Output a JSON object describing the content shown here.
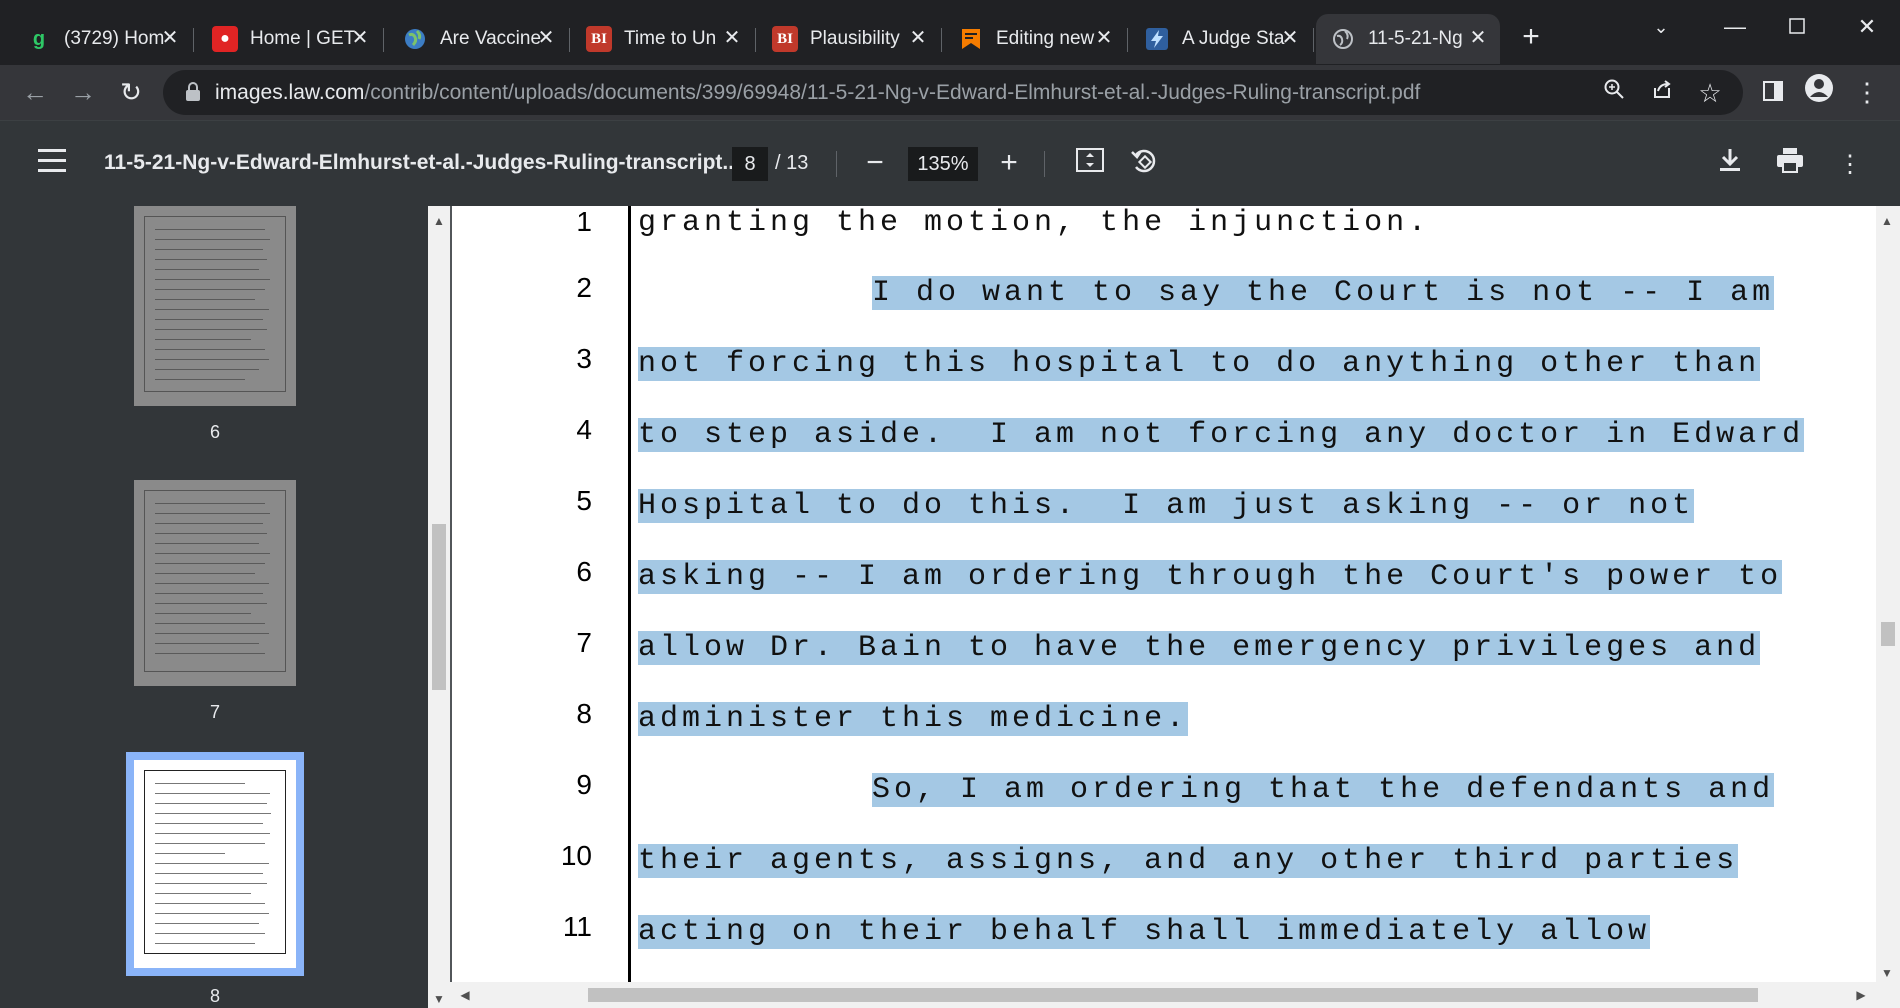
{
  "tabs": [
    {
      "title": "(3729) Hom",
      "favicon": "g",
      "favicon_color": "#2ec866"
    },
    {
      "title": "Home | GET",
      "favicon": "G",
      "favicon_color": "#e02424"
    },
    {
      "title": "Are Vaccine",
      "favicon": "globe-icon",
      "favicon_color": "#6fa8dc"
    },
    {
      "title": "Time to Un",
      "favicon": "BI",
      "favicon_color": "#c0392b"
    },
    {
      "title": "Plausibility",
      "favicon": "BI",
      "favicon_color": "#c0392b"
    },
    {
      "title": "Editing new",
      "favicon": "blogger-icon",
      "favicon_color": "#f57c00"
    },
    {
      "title": "A Judge Sta",
      "favicon": "bolt-icon",
      "favicon_color": "#5aa0e6"
    },
    {
      "title": "11-5-21-Ng",
      "favicon": "globe-icon",
      "favicon_color": "#bdc1c6"
    }
  ],
  "address": {
    "host": "images.law.com",
    "path": "/contrib/content/uploads/documents/399/69948/11-5-21-Ng-v-Edward-Elmhurst-et-al.-Judges-Ruling-transcript.pdf"
  },
  "pdf_toolbar": {
    "doc_title": "11-5-21-Ng-v-Edward-Elmhurst-et-al.-Judges-Ruling-transcript...",
    "current_page": "8",
    "total_pages": "/ 13",
    "zoom": "135%"
  },
  "thumbnails": [
    {
      "label": "6"
    },
    {
      "label": "7"
    },
    {
      "label": "8"
    }
  ],
  "transcript": [
    {
      "n": "1",
      "text": "granting the motion, the injunction."
    },
    {
      "n": "2",
      "text": "I do want to say the Court is not -- I am"
    },
    {
      "n": "3",
      "text": "not forcing this hospital to do anything other than"
    },
    {
      "n": "4",
      "text": "to step aside.  I am not forcing any doctor in Edward"
    },
    {
      "n": "5",
      "text": "Hospital to do this.  I am just asking -- or not"
    },
    {
      "n": "6",
      "text": "asking -- I am ordering through the Court's power to"
    },
    {
      "n": "7",
      "text": "allow Dr. Bain to have the emergency privileges and"
    },
    {
      "n": "8",
      "text": "administer this medicine."
    },
    {
      "n": "9",
      "text": "So, I am ordering that the defendants and"
    },
    {
      "n": "10",
      "text": "their agents, assigns, and any other third parties"
    },
    {
      "n": "11",
      "text": "acting on their behalf shall immediately allow"
    }
  ],
  "colors": {
    "selection": "#a4c8e4",
    "thumb_selected_outline": "#8ab4f8"
  }
}
